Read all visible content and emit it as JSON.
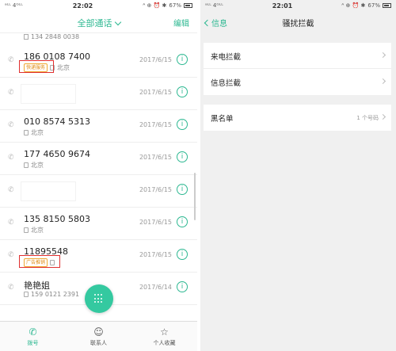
{
  "left": {
    "status": {
      "signal": "ᵃᴸᴸ 4ᴳᴸᴸ",
      "time": "22:02",
      "icons": "ᴬ ⊕ ⏰ ✱",
      "battery": "67%"
    },
    "header": {
      "title": "全部通话",
      "edit": "编辑"
    },
    "partial_row": {
      "number": "134 2848 0038"
    },
    "calls": [
      {
        "number": "186 0108 7400",
        "tag": "快递服务",
        "location": "北京",
        "date": "2017/6/15"
      },
      {
        "number": "",
        "location": "",
        "date": "2017/6/15",
        "blank": true
      },
      {
        "number": "010 8574 5313",
        "location": "北京",
        "date": "2017/6/15"
      },
      {
        "number": "177 4650 9674",
        "location": "北京",
        "date": "2017/6/15"
      },
      {
        "number": "",
        "location": "",
        "date": "2017/6/15",
        "blank": true
      },
      {
        "number": "135 8150 5803",
        "location": "北京",
        "date": "2017/6/15"
      },
      {
        "number": "11895548",
        "tag": "广告推销",
        "location": "",
        "date": "2017/6/15"
      },
      {
        "number": "艳艳姐",
        "location": "159 0121 2391",
        "date": "2017/6/14"
      }
    ],
    "tabs": [
      {
        "label": "拨号",
        "icon": "phone-icon"
      },
      {
        "label": "联系人",
        "icon": "contact-icon"
      },
      {
        "label": "个人收藏",
        "icon": "star-icon"
      }
    ]
  },
  "right": {
    "status": {
      "signal": "ᵃᴸᴸ 4ᴳᴸᴸ",
      "time": "22:01",
      "icons": "ᴬ ⊕ ⏰ ✱",
      "battery": "67%"
    },
    "header": {
      "back": "信息",
      "title": "骚扰拦截"
    },
    "group1": [
      {
        "label": "来电拦截"
      },
      {
        "label": "信息拦截"
      }
    ],
    "group2": [
      {
        "label": "黑名单",
        "value": "1 个号码"
      }
    ]
  },
  "colors": {
    "accent": "#2db891",
    "highlight_box": "#e03030",
    "tag": "#f0a830"
  }
}
